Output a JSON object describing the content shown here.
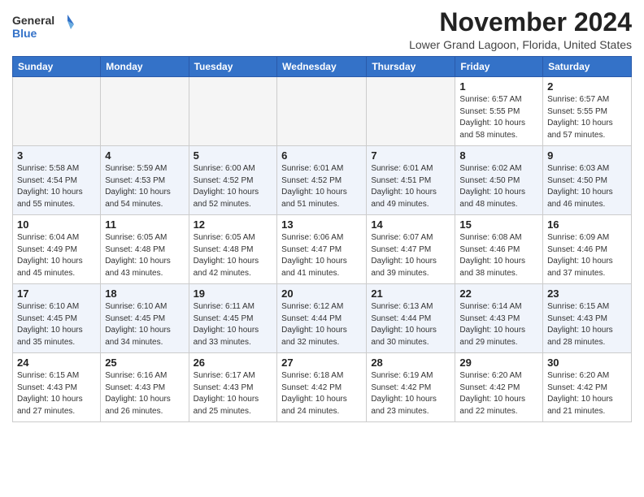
{
  "header": {
    "logo_line1": "General",
    "logo_line2": "Blue",
    "month": "November 2024",
    "location": "Lower Grand Lagoon, Florida, United States"
  },
  "days_of_week": [
    "Sunday",
    "Monday",
    "Tuesday",
    "Wednesday",
    "Thursday",
    "Friday",
    "Saturday"
  ],
  "weeks": [
    [
      {
        "day": "",
        "info": ""
      },
      {
        "day": "",
        "info": ""
      },
      {
        "day": "",
        "info": ""
      },
      {
        "day": "",
        "info": ""
      },
      {
        "day": "",
        "info": ""
      },
      {
        "day": "1",
        "info": "Sunrise: 6:57 AM\nSunset: 5:55 PM\nDaylight: 10 hours\nand 58 minutes."
      },
      {
        "day": "2",
        "info": "Sunrise: 6:57 AM\nSunset: 5:55 PM\nDaylight: 10 hours\nand 57 minutes."
      }
    ],
    [
      {
        "day": "3",
        "info": "Sunrise: 5:58 AM\nSunset: 4:54 PM\nDaylight: 10 hours\nand 55 minutes."
      },
      {
        "day": "4",
        "info": "Sunrise: 5:59 AM\nSunset: 4:53 PM\nDaylight: 10 hours\nand 54 minutes."
      },
      {
        "day": "5",
        "info": "Sunrise: 6:00 AM\nSunset: 4:52 PM\nDaylight: 10 hours\nand 52 minutes."
      },
      {
        "day": "6",
        "info": "Sunrise: 6:01 AM\nSunset: 4:52 PM\nDaylight: 10 hours\nand 51 minutes."
      },
      {
        "day": "7",
        "info": "Sunrise: 6:01 AM\nSunset: 4:51 PM\nDaylight: 10 hours\nand 49 minutes."
      },
      {
        "day": "8",
        "info": "Sunrise: 6:02 AM\nSunset: 4:50 PM\nDaylight: 10 hours\nand 48 minutes."
      },
      {
        "day": "9",
        "info": "Sunrise: 6:03 AM\nSunset: 4:50 PM\nDaylight: 10 hours\nand 46 minutes."
      }
    ],
    [
      {
        "day": "10",
        "info": "Sunrise: 6:04 AM\nSunset: 4:49 PM\nDaylight: 10 hours\nand 45 minutes."
      },
      {
        "day": "11",
        "info": "Sunrise: 6:05 AM\nSunset: 4:48 PM\nDaylight: 10 hours\nand 43 minutes."
      },
      {
        "day": "12",
        "info": "Sunrise: 6:05 AM\nSunset: 4:48 PM\nDaylight: 10 hours\nand 42 minutes."
      },
      {
        "day": "13",
        "info": "Sunrise: 6:06 AM\nSunset: 4:47 PM\nDaylight: 10 hours\nand 41 minutes."
      },
      {
        "day": "14",
        "info": "Sunrise: 6:07 AM\nSunset: 4:47 PM\nDaylight: 10 hours\nand 39 minutes."
      },
      {
        "day": "15",
        "info": "Sunrise: 6:08 AM\nSunset: 4:46 PM\nDaylight: 10 hours\nand 38 minutes."
      },
      {
        "day": "16",
        "info": "Sunrise: 6:09 AM\nSunset: 4:46 PM\nDaylight: 10 hours\nand 37 minutes."
      }
    ],
    [
      {
        "day": "17",
        "info": "Sunrise: 6:10 AM\nSunset: 4:45 PM\nDaylight: 10 hours\nand 35 minutes."
      },
      {
        "day": "18",
        "info": "Sunrise: 6:10 AM\nSunset: 4:45 PM\nDaylight: 10 hours\nand 34 minutes."
      },
      {
        "day": "19",
        "info": "Sunrise: 6:11 AM\nSunset: 4:45 PM\nDaylight: 10 hours\nand 33 minutes."
      },
      {
        "day": "20",
        "info": "Sunrise: 6:12 AM\nSunset: 4:44 PM\nDaylight: 10 hours\nand 32 minutes."
      },
      {
        "day": "21",
        "info": "Sunrise: 6:13 AM\nSunset: 4:44 PM\nDaylight: 10 hours\nand 30 minutes."
      },
      {
        "day": "22",
        "info": "Sunrise: 6:14 AM\nSunset: 4:43 PM\nDaylight: 10 hours\nand 29 minutes."
      },
      {
        "day": "23",
        "info": "Sunrise: 6:15 AM\nSunset: 4:43 PM\nDaylight: 10 hours\nand 28 minutes."
      }
    ],
    [
      {
        "day": "24",
        "info": "Sunrise: 6:15 AM\nSunset: 4:43 PM\nDaylight: 10 hours\nand 27 minutes."
      },
      {
        "day": "25",
        "info": "Sunrise: 6:16 AM\nSunset: 4:43 PM\nDaylight: 10 hours\nand 26 minutes."
      },
      {
        "day": "26",
        "info": "Sunrise: 6:17 AM\nSunset: 4:43 PM\nDaylight: 10 hours\nand 25 minutes."
      },
      {
        "day": "27",
        "info": "Sunrise: 6:18 AM\nSunset: 4:42 PM\nDaylight: 10 hours\nand 24 minutes."
      },
      {
        "day": "28",
        "info": "Sunrise: 6:19 AM\nSunset: 4:42 PM\nDaylight: 10 hours\nand 23 minutes."
      },
      {
        "day": "29",
        "info": "Sunrise: 6:20 AM\nSunset: 4:42 PM\nDaylight: 10 hours\nand 22 minutes."
      },
      {
        "day": "30",
        "info": "Sunrise: 6:20 AM\nSunset: 4:42 PM\nDaylight: 10 hours\nand 21 minutes."
      }
    ]
  ]
}
